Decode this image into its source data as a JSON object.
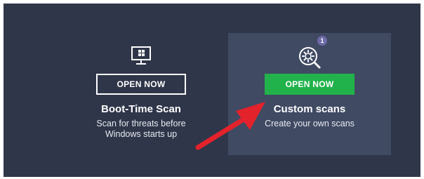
{
  "cards": [
    {
      "icon": "monitor-windows-icon",
      "button_label": "OPEN NOW",
      "title": "Boot-Time Scan",
      "description": "Scan for threats before Windows starts up"
    },
    {
      "icon": "gear-magnifier-icon",
      "badge_count": "1",
      "button_label": "OPEN NOW",
      "title": "Custom scans",
      "description": "Create your own scans"
    }
  ],
  "colors": {
    "panel_bg": "#2f3649",
    "card_highlight_bg": "#404a63",
    "button_green": "#22b24c",
    "badge_purple": "#6e6aa8",
    "annotation_arrow": "#e3222b"
  },
  "annotation": {
    "icon": "red-arrow-pointer-icon"
  }
}
